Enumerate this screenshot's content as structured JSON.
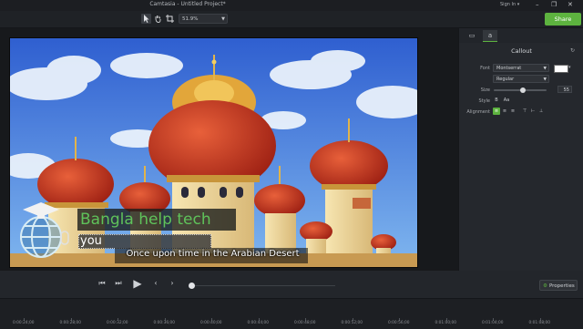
{
  "window": {
    "title": "Camtasia - Untitled Project*",
    "signin": "Sign In ▾",
    "controls": [
      "–",
      "❐",
      "✕"
    ]
  },
  "toolbar": {
    "tools": [
      "select-tool",
      "hand-tool",
      "crop-tool"
    ],
    "zoom_value": "51.9%",
    "share_label": "Share"
  },
  "canvas": {
    "callout_title": "Bangla help tech",
    "caption_edit_text": "you",
    "subtitle": "Once upon time in the Arabian Desert"
  },
  "panel": {
    "tabs": [
      "screen-tab",
      "text-tab"
    ],
    "title": "Callout",
    "font_label": "Font",
    "font_value": "Montserrat",
    "font_weight": "Regular",
    "size_label": "Size",
    "size_value": "55",
    "size_fraction": 0.55,
    "style_label": "Style",
    "style_bold": "B",
    "style_italic": "Aa",
    "alignment_label": "Alignment",
    "properties_label": "Properties",
    "colors": {
      "accent": "#5db33f",
      "font_color": "#ffffff"
    }
  },
  "playback": {
    "buttons": [
      "rewind",
      "step-forward",
      "play",
      "prev",
      "next"
    ]
  },
  "timeline": {
    "ticks": [
      "0:00:24;00",
      "0:00:28;00",
      "0:00:32;00",
      "0:00:36;00",
      "0:00:40;00",
      "0:00:44;00",
      "0:00:48;00",
      "0:00:52;00",
      "0:00:56;00",
      "0:01:00;00",
      "0:01:04;00",
      "0:01:08;00"
    ]
  }
}
